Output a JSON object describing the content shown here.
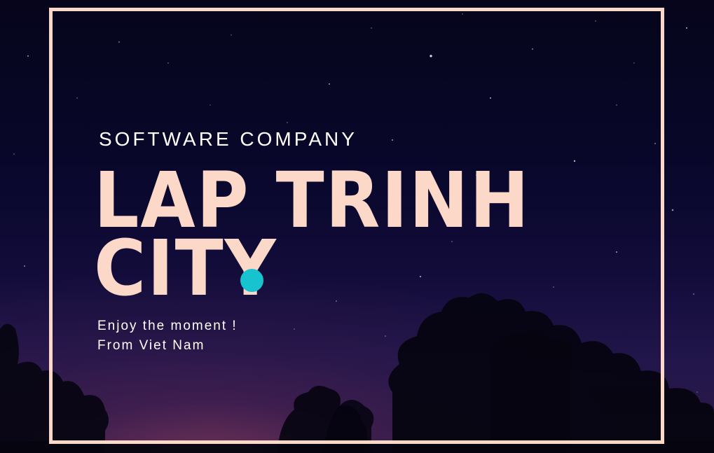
{
  "hero": {
    "eyebrow": "SOFTWARE COMPANY",
    "title_line1": "LAP TRINH",
    "title_line2": "CITY",
    "tagline_line1": "Enjoy the moment !",
    "tagline_line2": "From Viet Nam"
  },
  "colors": {
    "frame": "#fbd8c8",
    "title": "#fbd8c8",
    "accent_dot": "#17c3cf",
    "text": "#ffffff",
    "sky_top": "#06051b",
    "sky_bottom": "#2e1a48"
  },
  "icons": {
    "cursor_indicator": "teal-dot-icon"
  }
}
